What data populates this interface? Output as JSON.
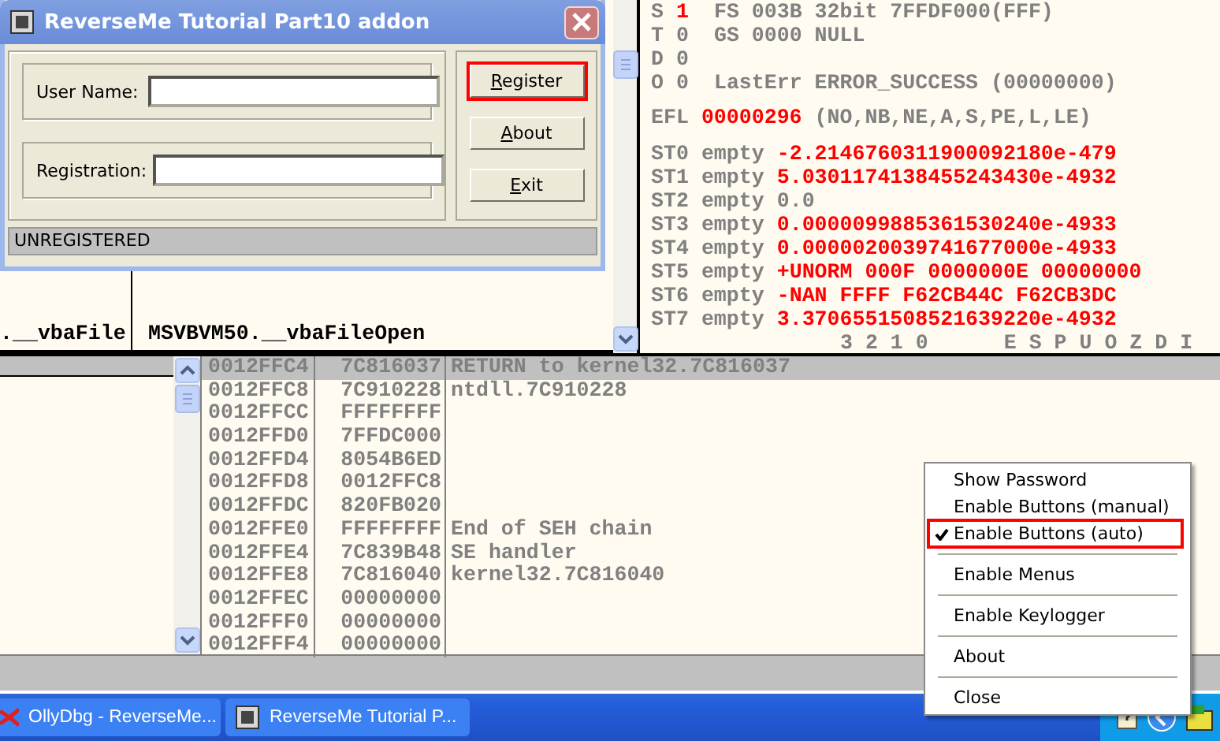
{
  "disassembly": {
    "column_1": ".__vbaFile",
    "column_2": "MSVBVM50.__vbaFileOpen"
  },
  "registers": {
    "flag_rows": [
      {
        "flag": "S",
        "value": "1",
        "changed": true,
        "info": "FS 003B 32bit 7FFDF000(FFF)"
      },
      {
        "flag": "T",
        "value": "0",
        "changed": false,
        "info": "GS 0000 NULL"
      },
      {
        "flag": "D",
        "value": "0",
        "changed": false,
        "info": ""
      },
      {
        "flag": "O",
        "value": "0",
        "changed": false,
        "info": "LastErr ERROR_SUCCESS (00000000)"
      }
    ],
    "efl": {
      "label": "EFL",
      "value": "00000296",
      "changed": true,
      "info": "(NO,NB,NE,A,S,PE,L,LE)"
    },
    "fpu_rows": [
      {
        "name": "ST0",
        "tag": "empty",
        "value": "-2.2146760311900092180e-479",
        "changed": true
      },
      {
        "name": "ST1",
        "tag": "empty",
        "value": "5.0301174138455243430e-4932",
        "changed": true
      },
      {
        "name": "ST2",
        "tag": "empty",
        "value": "0.0",
        "changed": false
      },
      {
        "name": "ST3",
        "tag": "empty",
        "value": "0.0000099885361530240e-4933",
        "changed": true
      },
      {
        "name": "ST4",
        "tag": "empty",
        "value": "0.0000020039741677000e-4933",
        "changed": true
      },
      {
        "name": "ST5",
        "tag": "empty",
        "value": "+UNORM 000F 0000000E 00000000",
        "changed": true
      },
      {
        "name": "ST6",
        "tag": "empty",
        "value": "-NAN FFFF F62CB44C F62CB3DC",
        "changed": true
      },
      {
        "name": "ST7",
        "tag": "empty",
        "value": "3.3706551508521639220e-4932",
        "changed": true
      }
    ],
    "fpu_footer": {
      "bits": "3 2 1 0",
      "flags": "E S P U O Z D I"
    }
  },
  "stack": {
    "rows": [
      {
        "address": "0012FFC4",
        "value": "7C816037",
        "comment": "RETURN to kernel32.7C816037",
        "selected": true
      },
      {
        "address": "0012FFC8",
        "value": "7C910228",
        "comment": "ntdll.7C910228",
        "selected": false
      },
      {
        "address": "0012FFCC",
        "value": "FFFFFFFF",
        "comment": "",
        "selected": false
      },
      {
        "address": "0012FFD0",
        "value": "7FFDC000",
        "comment": "",
        "selected": false
      },
      {
        "address": "0012FFD4",
        "value": "8054B6ED",
        "comment": "",
        "selected": false
      },
      {
        "address": "0012FFD8",
        "value": "0012FFC8",
        "comment": "",
        "selected": false
      },
      {
        "address": "0012FFDC",
        "value": "820FB020",
        "comment": "",
        "selected": false
      },
      {
        "address": "0012FFE0",
        "value": "FFFFFFFF",
        "comment": "End of SEH chain",
        "selected": false
      },
      {
        "address": "0012FFE4",
        "value": "7C839B48",
        "comment": "SE handler",
        "selected": false
      },
      {
        "address": "0012FFE8",
        "value": "7C816040",
        "comment": "kernel32.7C816040",
        "selected": false
      },
      {
        "address": "0012FFEC",
        "value": "00000000",
        "comment": "",
        "selected": false
      },
      {
        "address": "0012FFF0",
        "value": "00000000",
        "comment": "",
        "selected": false
      },
      {
        "address": "0012FFF4",
        "value": "00000000",
        "comment": "",
        "selected": false
      }
    ]
  },
  "dialog": {
    "title": "ReverseMe Tutorial Part10 addon",
    "fields": [
      {
        "label": "User Name:"
      },
      {
        "label": "Registration:"
      }
    ],
    "buttons": [
      {
        "label": "Register",
        "highlighted": true
      },
      {
        "label": "About",
        "highlighted": false
      },
      {
        "label": "Exit",
        "highlighted": false
      }
    ],
    "status": "UNREGISTERED"
  },
  "context_menu": {
    "groups": [
      [
        {
          "label": "Show Password",
          "checked": false,
          "highlighted": false
        },
        {
          "label": "Enable Buttons (manual)",
          "checked": false,
          "highlighted": false
        },
        {
          "label": "Enable Buttons (auto)",
          "checked": true,
          "highlighted": true
        }
      ],
      [
        {
          "label": "Enable Menus",
          "checked": false,
          "highlighted": false
        }
      ],
      [
        {
          "label": "Enable Keylogger",
          "checked": false,
          "highlighted": false
        }
      ],
      [
        {
          "label": "About",
          "checked": false,
          "highlighted": false
        }
      ],
      [
        {
          "label": "Close",
          "checked": false,
          "highlighted": false
        }
      ]
    ]
  },
  "taskbar": {
    "buttons": [
      {
        "label": "OllyDbg - ReverseMe..."
      },
      {
        "label": "ReverseMe Tutorial P..."
      }
    ]
  }
}
